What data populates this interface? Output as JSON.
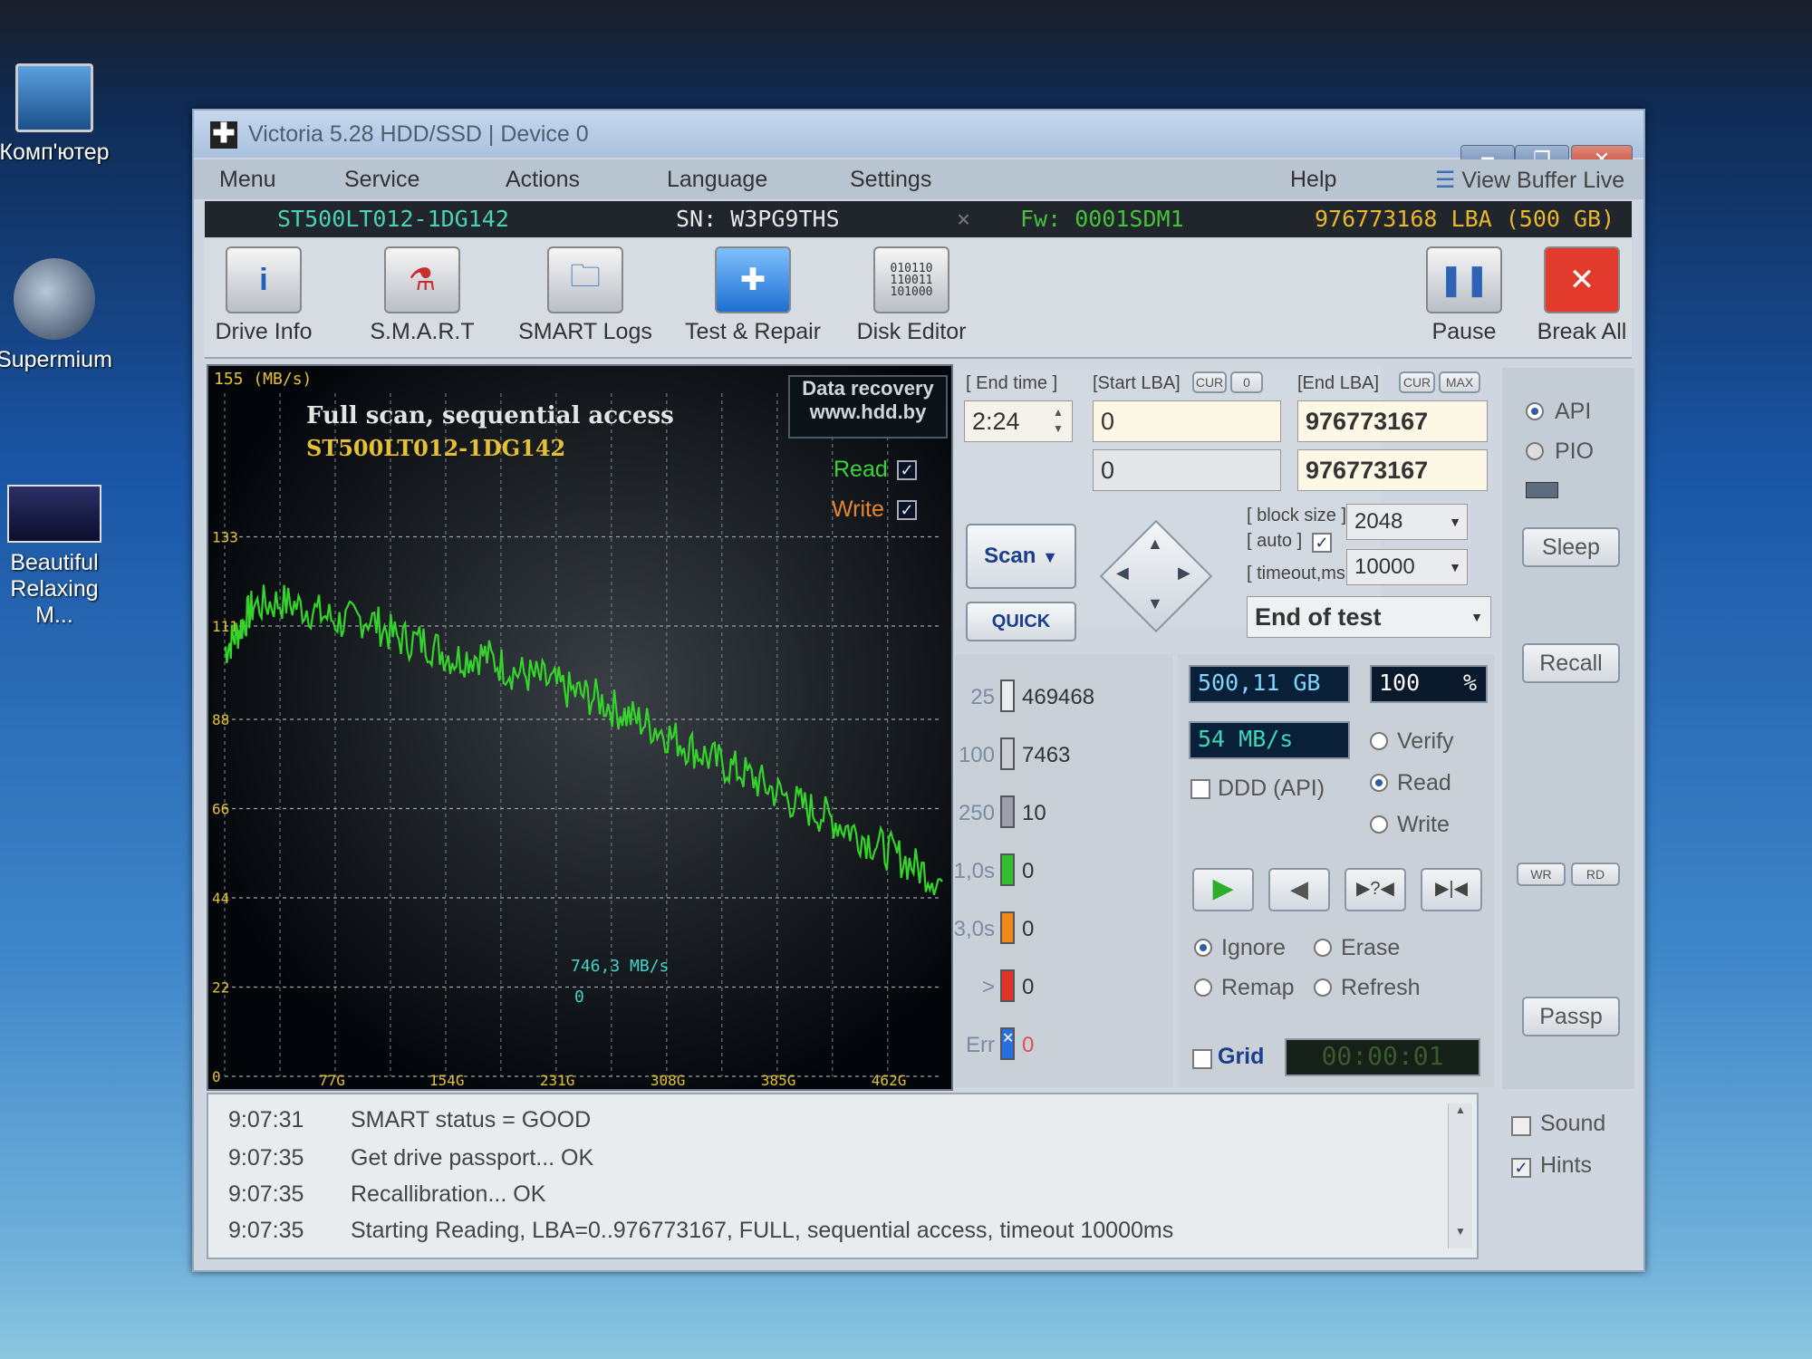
{
  "desktop": {
    "icons": [
      {
        "label": "Комп'ютер"
      },
      {
        "label": "Supermium"
      },
      {
        "label": "Beautiful Relaxing M..."
      }
    ]
  },
  "window": {
    "title": "Victoria 5.28 HDD/SSD | Device 0",
    "menu": [
      "Menu",
      "Service",
      "Actions",
      "Language",
      "Settings"
    ],
    "help": "Help",
    "view_buffer": "View Buffer Live"
  },
  "drive": {
    "model": "ST500LT012-1DG142",
    "serial": "SN: W3PG9THS",
    "firmware": "Fw: 0001SDM1",
    "capacity": "976773168 LBA (500 GB)"
  },
  "toolbar": {
    "drive_info": "Drive Info",
    "smart": "S.M.A.R.T",
    "smart_logs": "SMART Logs",
    "test_repair": "Test & Repair",
    "disk_editor": "Disk Editor",
    "pause": "Pause",
    "break_all": "Break All"
  },
  "chart_data": {
    "type": "line",
    "title": "Full scan, sequential access",
    "subtitle": "ST500LT012-1DG142",
    "ylabel": "155 (MB/s)",
    "ylim": [
      0,
      155
    ],
    "y_ticks": [
      "133",
      "111",
      "88",
      "66",
      "44",
      "22",
      "0"
    ],
    "x_ticks": [
      "77G",
      "154G",
      "231G",
      "308G",
      "385G",
      "462G"
    ],
    "xlim": [
      0,
      500
    ],
    "series": [
      {
        "name": "Read",
        "color": "#35d42a",
        "x": [
          0,
          10,
          20,
          40,
          60,
          80,
          100,
          120,
          140,
          160,
          180,
          200,
          220,
          240,
          260,
          280,
          300,
          320,
          340,
          360,
          380,
          400,
          420,
          440,
          460,
          480,
          500
        ],
        "values": [
          105,
          110,
          116,
          117,
          115,
          112,
          113,
          108,
          107,
          103,
          104,
          100,
          98,
          95,
          93,
          89,
          86,
          82,
          78,
          75,
          71,
          67,
          64,
          60,
          56,
          52,
          48
        ]
      }
    ],
    "legend": [
      {
        "label": "Read",
        "checked": true
      },
      {
        "label": "Write",
        "checked": true
      }
    ],
    "annotation_speed": "746,3 MB/s",
    "annotation_zero": "0",
    "watermark_line1": "Data recovery",
    "watermark_line2": "www.hdd.by"
  },
  "scan": {
    "end_time_label": "[ End time ]",
    "end_time": "2:24",
    "start_lba_label": "[Start LBA]",
    "end_lba_label": "[End LBA]",
    "cur": "CUR",
    "zero": "0",
    "max": "MAX",
    "start_lba": "0",
    "end_lba": "976773167",
    "start_lba2": "0",
    "end_lba2": "976773167",
    "block_size_label": "[ block size ]",
    "auto_label": "[ auto ]",
    "timeout_label": "[ timeout,ms ]",
    "block_size": "2048",
    "timeout": "10000",
    "scan_btn": "Scan",
    "quick_btn": "QUICK",
    "end_action": "End of test"
  },
  "stats": [
    {
      "tag": "25",
      "count": "469468",
      "color": "#e9ecef"
    },
    {
      "tag": "100",
      "count": "7463",
      "color": "#c8ccd2"
    },
    {
      "tag": "250",
      "count": "10",
      "color": "#9aa1ab"
    },
    {
      "tag": "1,0s",
      "count": "0",
      "color": "#33c030"
    },
    {
      "tag": "3,0s",
      "count": "0",
      "color": "#f08a1a"
    },
    {
      "tag": ">",
      "count": "0",
      "color": "#e0332a"
    },
    {
      "tag": "Err",
      "count": "0",
      "color": "#2a6fe0"
    }
  ],
  "progress": {
    "size": "500,11 GB",
    "percent": "100",
    "percent_sign": "%",
    "speed": "54 MB/s",
    "ddd": "DDD (API)",
    "verify": "Verify",
    "read": "Read",
    "write": "Write",
    "ignore": "Ignore",
    "erase": "Erase",
    "remap": "Remap",
    "refresh": "Refresh",
    "grid": "Grid",
    "timer": "00:00:01"
  },
  "right": {
    "api": "API",
    "pio": "PIO",
    "sleep": "Sleep",
    "recall": "Recall",
    "wr": "WR",
    "rd": "RD",
    "passp": "Passp",
    "sound": "Sound",
    "hints": "Hints"
  },
  "log": [
    {
      "time": "9:07:31",
      "msg": "SMART status = GOOD"
    },
    {
      "time": "9:07:35",
      "msg": "Get drive passport... OK"
    },
    {
      "time": "9:07:35",
      "msg": "Recallibration... OK"
    },
    {
      "time": "9:07:35",
      "msg": "Starting Reading, LBA=0..976773167, FULL, sequential access, timeout 10000ms"
    }
  ]
}
